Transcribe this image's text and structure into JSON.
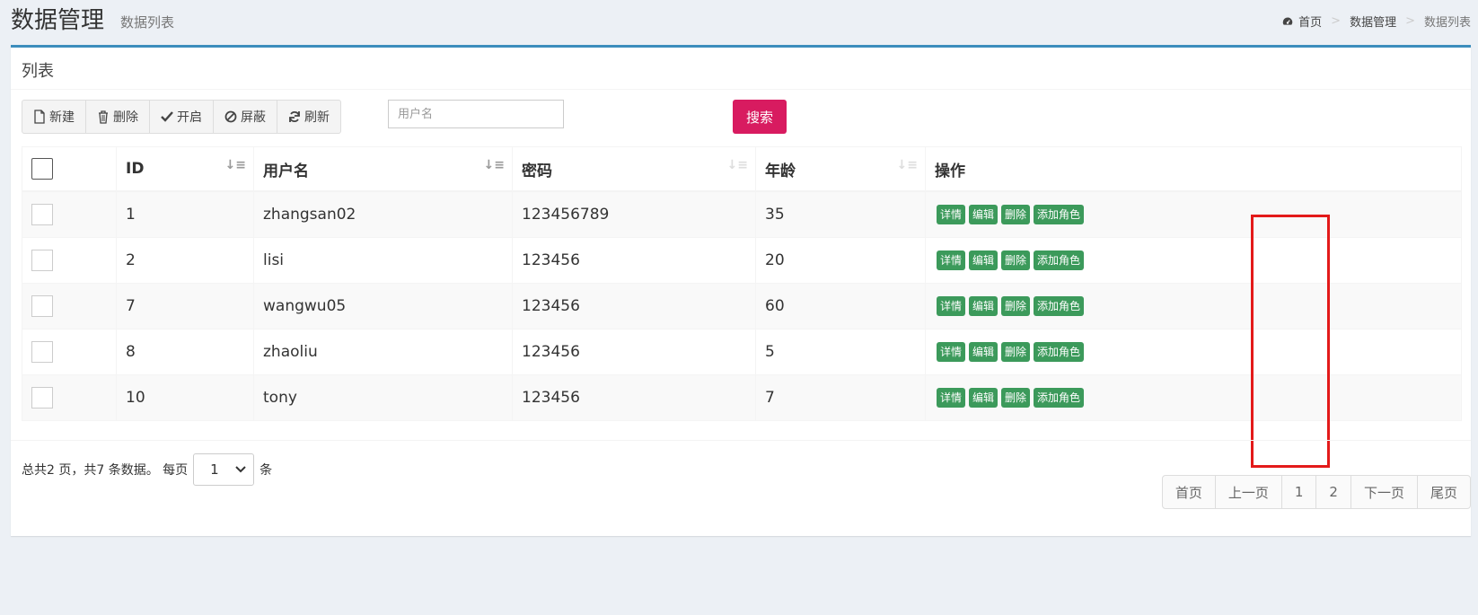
{
  "header": {
    "title": "数据管理",
    "subtitle": "数据列表",
    "breadcrumb": {
      "home": "首页",
      "section": "数据管理",
      "current": "数据列表",
      "separator": ">"
    }
  },
  "box": {
    "title": "列表"
  },
  "toolbar": {
    "new_label": "新建",
    "delete_label": "删除",
    "enable_label": "开启",
    "block_label": "屏蔽",
    "refresh_label": "刷新"
  },
  "search": {
    "placeholder": "用户名",
    "value": "",
    "button_label": "搜索"
  },
  "table": {
    "columns": {
      "id": "ID",
      "username": "用户名",
      "password": "密码",
      "age": "年龄",
      "actions": "操作"
    },
    "rows": [
      {
        "id": "1",
        "username": "zhangsan02",
        "password": "123456789",
        "age": "35",
        "checked": false
      },
      {
        "id": "2",
        "username": "lisi",
        "password": "123456",
        "age": "20",
        "checked": false
      },
      {
        "id": "7",
        "username": "wangwu05",
        "password": "123456",
        "age": "60",
        "checked": false
      },
      {
        "id": "8",
        "username": "zhaoliu",
        "password": "123456",
        "age": "5",
        "checked": false
      },
      {
        "id": "10",
        "username": "tony",
        "password": "123456",
        "age": "7",
        "checked": false
      }
    ],
    "row_actions": {
      "detail": "详情",
      "edit": "编辑",
      "delete": "删除",
      "add_role": "添加角色"
    }
  },
  "footer": {
    "summary_prefix": "总共2 页，共7 条数据。 每页",
    "page_size": "1",
    "summary_suffix": "条"
  },
  "pagination": {
    "first": "首页",
    "prev": "上一页",
    "pages": [
      "1",
      "2"
    ],
    "next": "下一页",
    "last": "尾页"
  },
  "colors": {
    "accent": "#3c8dbc",
    "search_button": "#d81b60",
    "action_button": "#3c9a5b",
    "highlight": "#e31a1a"
  },
  "icons": {
    "breadcrumb_home": "dashboard-icon",
    "new": "file-icon",
    "delete": "trash-icon",
    "enable": "check-icon",
    "block": "ban-icon",
    "refresh": "refresh-icon",
    "sort": "sort-icon",
    "select": "chevron-down-icon"
  }
}
